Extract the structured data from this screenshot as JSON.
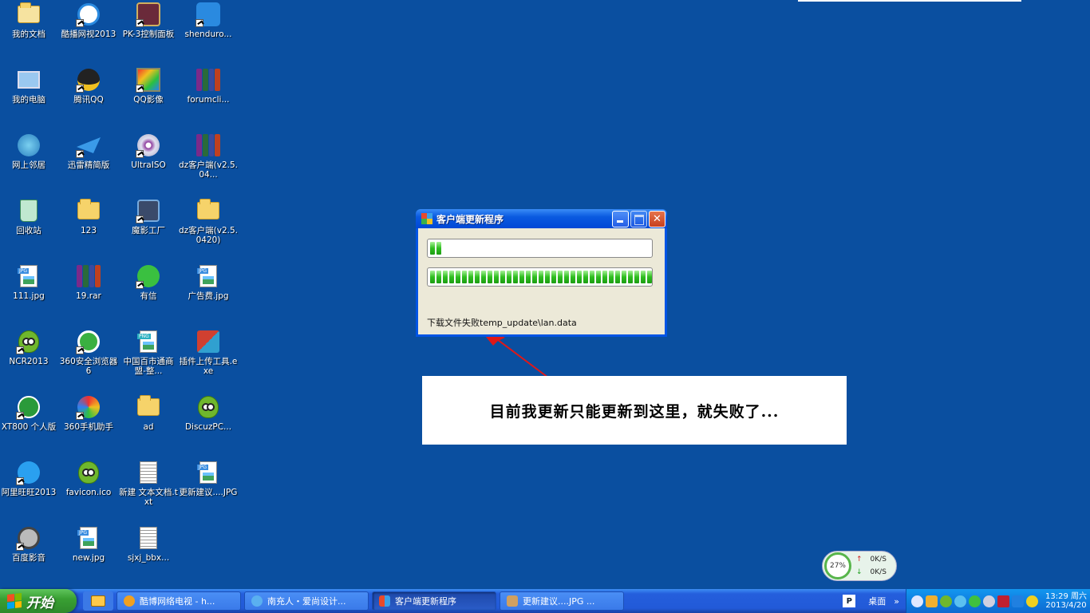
{
  "desktop_icons": [
    {
      "label": "我的文档"
    },
    {
      "label": "酷播网视2013"
    },
    {
      "label": "PK-3控制面板"
    },
    {
      "label": "shenduro..."
    },
    {
      "label": "我的电脑"
    },
    {
      "label": "腾讯QQ"
    },
    {
      "label": "QQ影像"
    },
    {
      "label": "forumcli..."
    },
    {
      "label": "网上邻居"
    },
    {
      "label": "迅雷精简版"
    },
    {
      "label": "UltraISO"
    },
    {
      "label": "dz客户端(v2.5.04..."
    },
    {
      "label": "回收站"
    },
    {
      "label": "123"
    },
    {
      "label": "魔影工厂"
    },
    {
      "label": "dz客户端(v2.5.0420)"
    },
    {
      "label": "111.jpg"
    },
    {
      "label": "19.rar"
    },
    {
      "label": "有信"
    },
    {
      "label": "广告费.jpg"
    },
    {
      "label": "NCR2013"
    },
    {
      "label": "360安全浏览器6"
    },
    {
      "label": "中国百市通商盟-整..."
    },
    {
      "label": "插件上传工具.exe"
    },
    {
      "label": "XT800 个人版"
    },
    {
      "label": "360手机助手"
    },
    {
      "label": "ad"
    },
    {
      "label": "DiscuzPC..."
    },
    {
      "label": "阿里旺旺2013"
    },
    {
      "label": "favicon.ico"
    },
    {
      "label": "新建 文本文档.txt"
    },
    {
      "label": "更新建议....JPG"
    },
    {
      "label": "百度影音"
    },
    {
      "label": "new.jpg"
    },
    {
      "label": "sjxj_bbx..."
    }
  ],
  "dialog": {
    "title": "客户端更新程序",
    "progress_file": 0.05,
    "progress_total": 1.0,
    "status": "下载文件失败temp_update\\lan.data"
  },
  "annotation": {
    "text": "目前我更新只能更新到这里，就失败了..."
  },
  "netmon": {
    "percent": "27%",
    "up": "0K/S",
    "down": "0K/S"
  },
  "taskbar": {
    "start_label": "开始",
    "tasks": [
      {
        "label": "酷博网络电视 - h...",
        "active": false
      },
      {
        "label": "南充人・爱尚设计...",
        "active": false
      },
      {
        "label": "客户端更新程序",
        "active": true
      },
      {
        "label": "更新建议....JPG ...",
        "active": false
      }
    ],
    "desktop_label": "桌面",
    "time": "13:29 周六",
    "date": "2013/4/20"
  },
  "colors": {
    "desktop": "#0a4fa0",
    "xp_blue": "#0055e5",
    "progress_green": "#2fbe1f"
  }
}
